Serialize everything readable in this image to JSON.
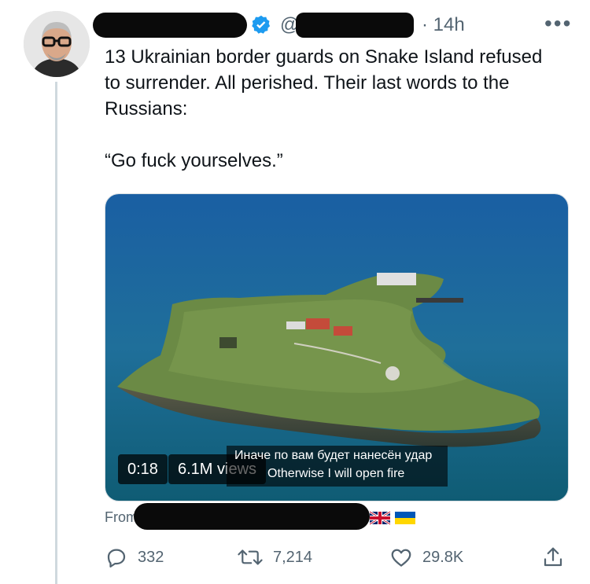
{
  "tweet": {
    "handle_prefix": "@",
    "timestamp": "· 14h",
    "more_label": "•••",
    "text_lines": [
      "13 Ukrainian border guards on Snake Island refused",
      "to surrender. All perished. Their last words to the",
      "Russians:"
    ],
    "quote": "“Go fuck yourselves.”"
  },
  "media": {
    "duration": "0:18",
    "views": "6.1M views",
    "subtitle_ru": "Иначе по вам будет нанесён удар",
    "subtitle_en": "Otherwise I will open fire"
  },
  "attribution": {
    "prefix": "From"
  },
  "actions": {
    "replies": "332",
    "retweets": "7,214",
    "likes": "29.8K"
  },
  "colors": {
    "text": "#0f1419",
    "muted": "#536471",
    "verified": "#1d9bf0",
    "redaction": "#0a0a0a"
  }
}
